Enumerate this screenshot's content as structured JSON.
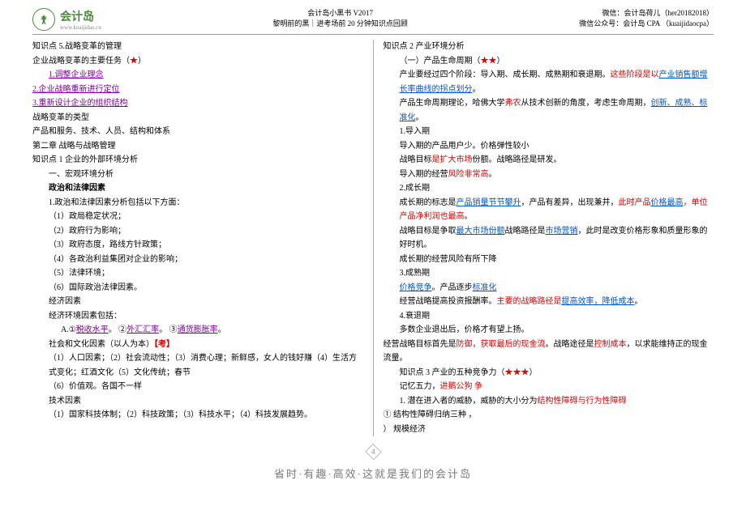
{
  "header": {
    "logo_name": "会计岛",
    "logo_url": "www.kuaijidao.cn",
    "title_line1": "会计岛小黑书 V2017",
    "title_line2": "黎明前的黑｜进考场前 20 分钟知识点回顾",
    "wx_label": "微信：",
    "wx_val": "会计岛荷儿（her20182018）",
    "gzh_label": "微信公众号：",
    "gzh_val": "会计岛 CPA （kuaijidaocpa）"
  },
  "left": {
    "l01": "知识点 5.战略变革的管理",
    "l02a": "企业战略变革的主要任务（",
    "l02b": "★",
    "l02c": "）",
    "l03": "1.调整企业理念",
    "l04": "2.企业战略重新进行定位",
    "l05": "3.重新设计企业的组织结构",
    "l06": "战略变革的类型",
    "l07": "产品和服务、技术、人员、结构和体系",
    "l08": "第二章  战略与战略管理",
    "l09": "知识点 1  企业的外部环境分析",
    "l10": "一、宏观环境分析",
    "l11": "政治和法律因素",
    "l12": "1.政治和法律因素分析包括以下方面：",
    "l13": "（1）政局稳定状况；",
    "l14": "（2）政府行为影响；",
    "l15": "（3）政府态度，路线方针政策；",
    "l16": "（4）各政治利益集团对企业的影响；",
    "l17": "（5）法律环境；",
    "l18": "（6）国际政治法律因素。",
    "l19": "经济因素",
    "l20": "经济环境因素包括：",
    "l21a": "A.①",
    "l21b": "税收水平",
    "l21c": "。    ②",
    "l21d": "外汇汇率",
    "l21e": "。    ③",
    "l21f": "通货膨胀率",
    "l21g": "。",
    "l22a": "社会和文化因素（以人为本）",
    "l22b": "【考】",
    "l23": "（1）人口因素；（2）社会流动性；（3）消费心理；新鲜感，女人的钱好赚（4）生活方式变化；红酒文化（5）文化传统；春节",
    "l24": "（6）价值观。各国不一样",
    "l25": "技术因素",
    "l26": "（1）国家科技体制；（2）科技政策；（3）科技水平；（4）科技发展趋势。"
  },
  "right": {
    "r01": "知识点 2  产业环境分析",
    "r02a": "（一）产品生命周期（",
    "r02b": "★★",
    "r02c": "）",
    "r03a": "产业要经过四个阶段：导入期、成长期、成熟期和衰退期。",
    "r03b": "这些阶段是以",
    "r03c": "产业销售额增长率曲线的拐点划分",
    "r03d": "。",
    "r04a": "产品生命周期理论，哈佛大学",
    "r04b": "弗农",
    "r04c": "从技术创新的角度，考虑生命周期，",
    "r04d": "创新、成熟、标准化",
    "r04e": "。",
    "r05": "1.导入期",
    "r06": "导入期的产品用户少。价格弹性较小",
    "r07a": "战略目标",
    "r07b": "是扩大市场",
    "r07c": "份额。战略路径是研发。",
    "r08a": "导入期的经营",
    "r08b": "风险非常高",
    "r08c": "。",
    "r09": "2.成长期",
    "r10a": "成长期的标志是",
    "r10b": "产品销量节节攀升",
    "r10c": "，产品有差异，出现兼并，",
    "r10d": "此时产品",
    "r10e": "价格最高",
    "r10f": "，",
    "r10g": "单位产品净利润也最高",
    "r10h": "。",
    "r11a": "战略目标是争取",
    "r11b": "最大市场份额",
    "r11c": "战略路径是",
    "r11d": "市场营销",
    "r11e": "，此时是改变价格形象和质量形象的好时机。",
    "r12": "成长期的经营风险有所下降",
    "r13": "3.成熟期",
    "r14a": "价格竞争",
    "r14b": "。产品逐步",
    "r14c": "标准化",
    "r15a": "经营战略提高投资报酬率。",
    "r15b": "主要的战略路径是",
    "r15c": "提高效率，降低成本",
    "r15d": "。",
    "r16": "4.衰退期",
    "r17": "多数企业退出后，价格才有望上扬。",
    "r18a": "经营战略目标首先是",
    "r18b": "防御，获取最后的现金流",
    "r18c": "。战略途径是",
    "r18d": "控制成本",
    "r18e": "，以求能维持正的现金流量。",
    "r19a": "知识点 3  产业的五种竞争力（",
    "r19b": "★★★",
    "r19c": "）",
    "r20a": "记忆五力，",
    "r20b": "进鹅公狗  争",
    "r21a": "1.  潜在进入者的威胁，威胁的大小分为",
    "r21b": "结构性障碍与行为性障碍",
    "r22": "①  结构性障碍归纳三种 ，",
    "r23": "）  规模经济"
  },
  "footer": {
    "pagenum": "4",
    "slogan": "省时·有趣·高效·这就是我们的会计岛"
  }
}
